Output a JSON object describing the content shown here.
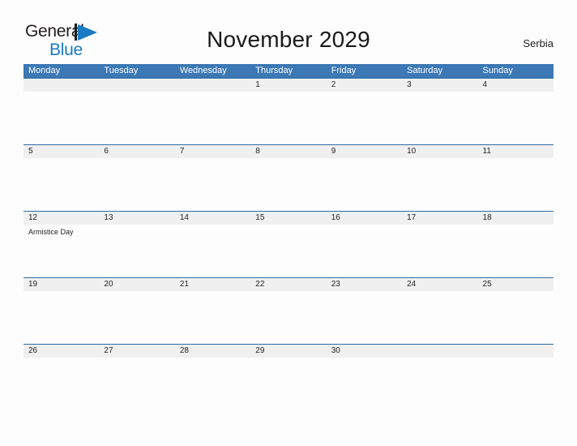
{
  "brand": {
    "name_part1": "General",
    "name_part2": "Blue",
    "flag_icon": "blue-triangle-flag-icon",
    "color_dark": "#231f20",
    "color_blue": "#1a7ac4"
  },
  "header": {
    "title": "November 2029",
    "locale": "Serbia"
  },
  "theme": {
    "header_blue": "#3b78b4",
    "separator_blue": "#2e6da4",
    "date_band_gray": "#f0f0f0",
    "page_background": "#fdfdfd"
  },
  "calendar": {
    "month": "November",
    "year": "2029",
    "week_start": "Monday",
    "day_names": [
      "Monday",
      "Tuesday",
      "Wednesday",
      "Thursday",
      "Friday",
      "Saturday",
      "Sunday"
    ],
    "weeks": [
      {
        "dates": [
          "",
          "",
          "",
          "1",
          "2",
          "3",
          "4"
        ],
        "events": [
          [],
          [],
          [],
          [],
          [],
          [],
          []
        ]
      },
      {
        "dates": [
          "5",
          "6",
          "7",
          "8",
          "9",
          "10",
          "11"
        ],
        "events": [
          [],
          [],
          [],
          [],
          [],
          [],
          []
        ]
      },
      {
        "dates": [
          "12",
          "13",
          "14",
          "15",
          "16",
          "17",
          "18"
        ],
        "events": [
          [
            "Armistice Day"
          ],
          [],
          [],
          [],
          [],
          [],
          []
        ]
      },
      {
        "dates": [
          "19",
          "20",
          "21",
          "22",
          "23",
          "24",
          "25"
        ],
        "events": [
          [],
          [],
          [],
          [],
          [],
          [],
          []
        ]
      },
      {
        "dates": [
          "26",
          "27",
          "28",
          "29",
          "30",
          "",
          ""
        ],
        "events": [
          [],
          [],
          [],
          [],
          [],
          [],
          []
        ]
      }
    ],
    "holidays": [
      {
        "date": "12",
        "name": "Armistice Day"
      }
    ]
  }
}
